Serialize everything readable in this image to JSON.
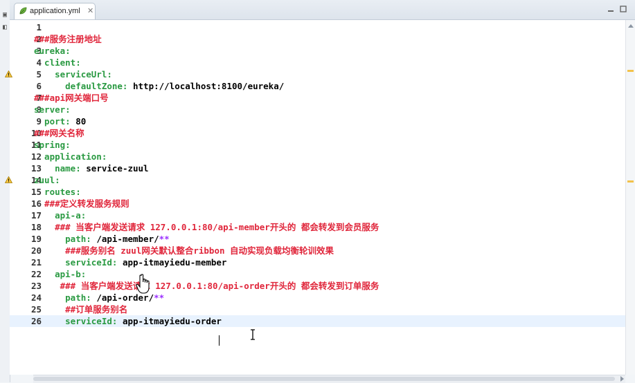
{
  "tab": {
    "title": "application.yml",
    "close_glyph": "✕",
    "icon": "spring-leaf-icon"
  },
  "window_controls": {
    "minimize": "▭",
    "maximize": "▭"
  },
  "editor": {
    "current_line": 26,
    "lines": [
      {
        "n": "1",
        "parts": []
      },
      {
        "n": "2",
        "parts": [
          {
            "t": "###服务注册地址",
            "c": "c"
          }
        ]
      },
      {
        "n": "3",
        "parts": [
          {
            "t": "eureka:",
            "c": "k"
          }
        ]
      },
      {
        "n": "4",
        "parts": [
          {
            "t": "  client:",
            "c": "k"
          }
        ]
      },
      {
        "n": "5",
        "parts": [
          {
            "t": "    serviceUrl:",
            "c": "k"
          }
        ],
        "warn": true
      },
      {
        "n": "6",
        "parts": [
          {
            "t": "      defaultZone: ",
            "c": "k"
          },
          {
            "t": "http://localhost:8100/eureka/",
            "c": "v"
          }
        ]
      },
      {
        "n": "7",
        "parts": [
          {
            "t": "###api网关端口号",
            "c": "c"
          }
        ]
      },
      {
        "n": "8",
        "parts": [
          {
            "t": "server:",
            "c": "k"
          }
        ]
      },
      {
        "n": "9",
        "parts": [
          {
            "t": "  port: ",
            "c": "k"
          },
          {
            "t": "80",
            "c": "v"
          }
        ]
      },
      {
        "n": "10",
        "parts": [
          {
            "t": "###网关名称",
            "c": "c"
          }
        ]
      },
      {
        "n": "11",
        "parts": [
          {
            "t": "spring:",
            "c": "k"
          }
        ]
      },
      {
        "n": "12",
        "parts": [
          {
            "t": "  application:",
            "c": "k"
          }
        ]
      },
      {
        "n": "13",
        "parts": [
          {
            "t": "    name: ",
            "c": "k"
          },
          {
            "t": "service-zuul",
            "c": "v"
          }
        ]
      },
      {
        "n": "14",
        "parts": [
          {
            "t": "zuul:",
            "c": "k"
          }
        ],
        "warn": true
      },
      {
        "n": "15",
        "parts": [
          {
            "t": "  routes:",
            "c": "k"
          }
        ]
      },
      {
        "n": "16",
        "parts": [
          {
            "t": "  ###定义转发服务规则",
            "c": "c"
          }
        ]
      },
      {
        "n": "17",
        "parts": [
          {
            "t": "    api-a:",
            "c": "k"
          }
        ]
      },
      {
        "n": "18",
        "parts": [
          {
            "t": "    ### 当客户端发送请求 127.0.0.1:80/api-member开头的 都会转发到会员服务",
            "c": "c"
          }
        ]
      },
      {
        "n": "19",
        "parts": [
          {
            "t": "      path: ",
            "c": "k"
          },
          {
            "t": "/api-member/",
            "c": "v"
          },
          {
            "t": "**",
            "c": "s"
          }
        ]
      },
      {
        "n": "20",
        "parts": [
          {
            "t": "      ###服务别名 zuul网关默认整合ribbon 自动实现负载均衡轮训效果",
            "c": "c"
          }
        ]
      },
      {
        "n": "21",
        "parts": [
          {
            "t": "      serviceId: ",
            "c": "k"
          },
          {
            "t": "app-itmayiedu-member",
            "c": "v"
          }
        ]
      },
      {
        "n": "22",
        "parts": [
          {
            "t": "    api-b:",
            "c": "k"
          }
        ]
      },
      {
        "n": "23",
        "parts": [
          {
            "t": "     ### 当客户端发送请求 127.0.0.1:80/api-order开头的 都会转发到订单服务",
            "c": "c"
          }
        ]
      },
      {
        "n": "24",
        "parts": [
          {
            "t": "      path: ",
            "c": "k"
          },
          {
            "t": "/api-order/",
            "c": "v"
          },
          {
            "t": "**",
            "c": "s"
          }
        ]
      },
      {
        "n": "25",
        "parts": [
          {
            "t": "      ##订单服务别名",
            "c": "c"
          }
        ]
      },
      {
        "n": "26",
        "parts": [
          {
            "t": "      serviceId: ",
            "c": "k"
          },
          {
            "t": "app-itmayiedu-order",
            "c": "v"
          }
        ]
      }
    ]
  },
  "colors": {
    "key": "#2a9a42",
    "comment": "#e0263b",
    "value": "#000000",
    "wildcard": "#9b30ff",
    "current_line": "#e8f2fe"
  }
}
